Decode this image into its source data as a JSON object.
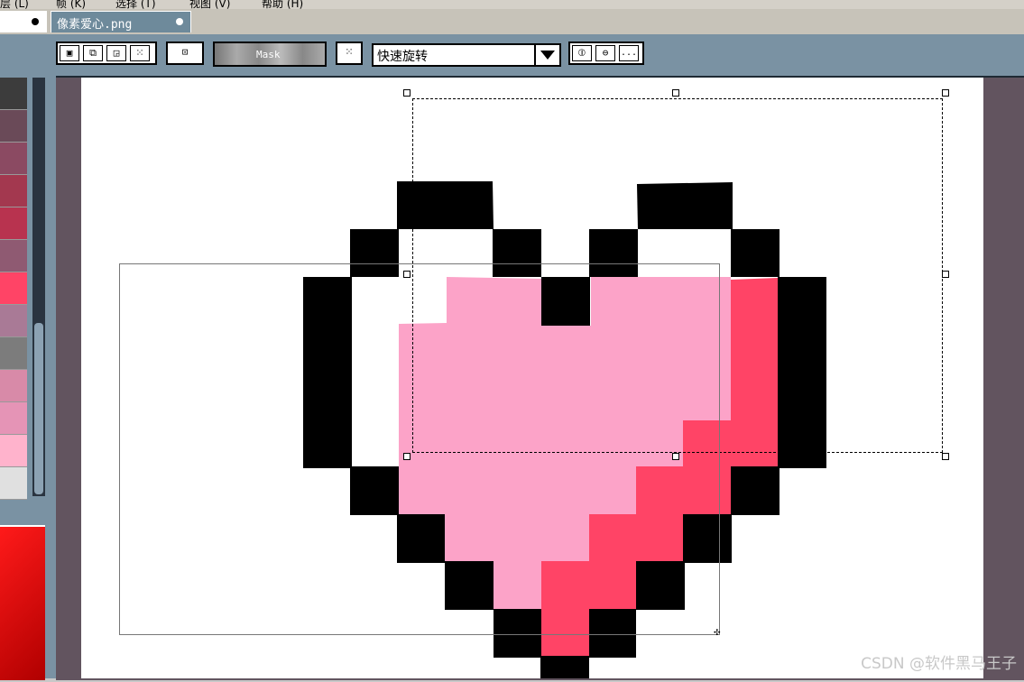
{
  "menu": {
    "items": [
      "层 (L)",
      "帧 (K)",
      "选择 (T)",
      "视图 (V)",
      "帮助 (H)"
    ]
  },
  "tabs": [
    {
      "label": "",
      "active": false
    },
    {
      "label": "像素爱心.png",
      "active": true
    }
  ],
  "toolbar": {
    "mask_label": "Mask",
    "transform_mode": "快速旋转",
    "more_label": "..."
  },
  "palette": {
    "swatches": [
      "#3c3c3c",
      "#6a4a58",
      "#8b4a62",
      "#a3384f",
      "#b8334f",
      "#8f5a72",
      "#ff4466",
      "#a97a96",
      "#7c7c7c",
      "#d88aa8",
      "#e594b6",
      "#ffb3cc",
      "#e0e0e0"
    ]
  },
  "colors": {
    "outline": "#000000",
    "fill_light": "#fca3c8",
    "fill_dark": "#ff4466",
    "canvas_bg": "#ffffff",
    "workspace_bg": "#62545f",
    "toolbar_bg": "#7a92a3"
  },
  "watermark": "CSDN @软件黑马王子"
}
